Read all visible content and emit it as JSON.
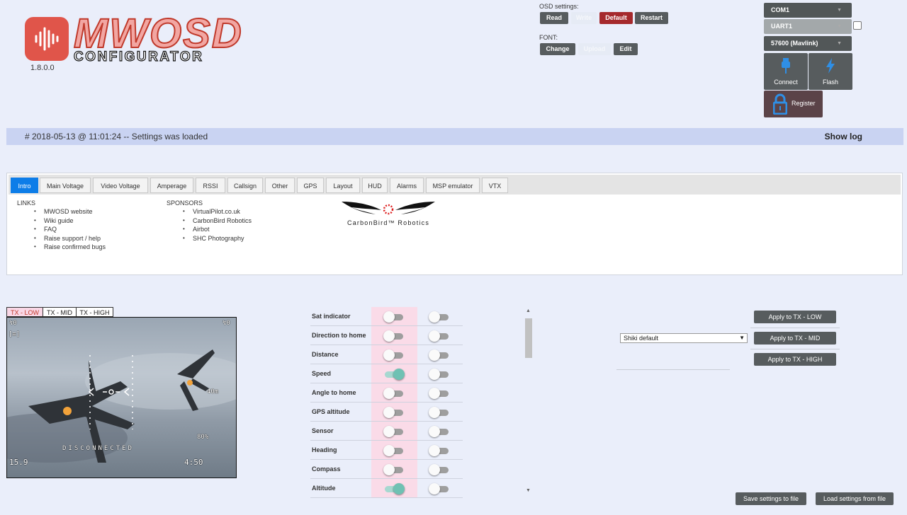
{
  "app": {
    "logo_main": "MWOSD",
    "logo_sub": "CONFIGURATOR",
    "version": "1.8.0.0"
  },
  "osd_settings": {
    "label": "OSD settings:",
    "read": "Read",
    "write": "Write",
    "default": "Default",
    "restart": "Restart"
  },
  "font": {
    "label": "FONT:",
    "change": "Change",
    "upload": "Upload",
    "edit": "Edit"
  },
  "serial": {
    "port": "COM1",
    "uart": "UART1",
    "baud": "57600 (Mavlink)",
    "connect": "Connect",
    "flash": "Flash",
    "register": "Register"
  },
  "status": {
    "message": "# 2018-05-13 @ 11:01:24 -- Settings was loaded",
    "show_log": "Show log"
  },
  "tabs": [
    "Intro",
    "Main Voltage",
    "Video Voltage",
    "Amperage",
    "RSSI",
    "Callsign",
    "Other",
    "GPS",
    "Layout",
    "HUD",
    "Alarms",
    "MSP emulator",
    "VTX"
  ],
  "intro": {
    "links_title": "LINKS",
    "links": [
      "MWOSD website",
      "Wiki guide",
      "FAQ",
      "Raise support / help",
      "Raise confirmed bugs"
    ],
    "sponsors_title": "SPONSORS",
    "sponsors": [
      "VirtualPilot.co.uk",
      "CarbonBird Robotics",
      "Airbot",
      "SHC Photography"
    ],
    "sponsor_logo_text": "CarbonBird™ Robotics"
  },
  "tx_tabs": [
    "TX - LOW",
    "TX - MID",
    "TX - HIGH"
  ],
  "osd_preview": {
    "disconnected": "DISCONNECTED",
    "altitude_readout": "40m",
    "percent_readout": "80%",
    "voltage_readout": "15.9",
    "timer_readout": "4:50"
  },
  "elements": [
    {
      "name": "Sat indicator",
      "low": false,
      "mid": false
    },
    {
      "name": "Direction to home",
      "low": false,
      "mid": false
    },
    {
      "name": "Distance",
      "low": false,
      "mid": false
    },
    {
      "name": "Speed",
      "low": true,
      "mid": false
    },
    {
      "name": "Angle to home",
      "low": false,
      "mid": false
    },
    {
      "name": "GPS altitude",
      "low": false,
      "mid": false
    },
    {
      "name": "Sensor",
      "low": false,
      "mid": false
    },
    {
      "name": "Heading",
      "low": false,
      "mid": false
    },
    {
      "name": "Compass",
      "low": false,
      "mid": false
    },
    {
      "name": "Altitude",
      "low": true,
      "mid": false
    }
  ],
  "preset": {
    "selected": "Shiki default",
    "apply_low": "Apply to TX - LOW",
    "apply_mid": "Apply to TX - MID",
    "apply_high": "Apply to TX - HIGH"
  },
  "files": {
    "save": "Save settings to file",
    "load": "Load settings from file"
  },
  "colors": {
    "accent_blue": "#0d7de8",
    "logo_red": "#e0554a",
    "default_red": "#a5292c",
    "toggle_on": "#6fc1b3",
    "pink_column": "#fadbe8"
  }
}
